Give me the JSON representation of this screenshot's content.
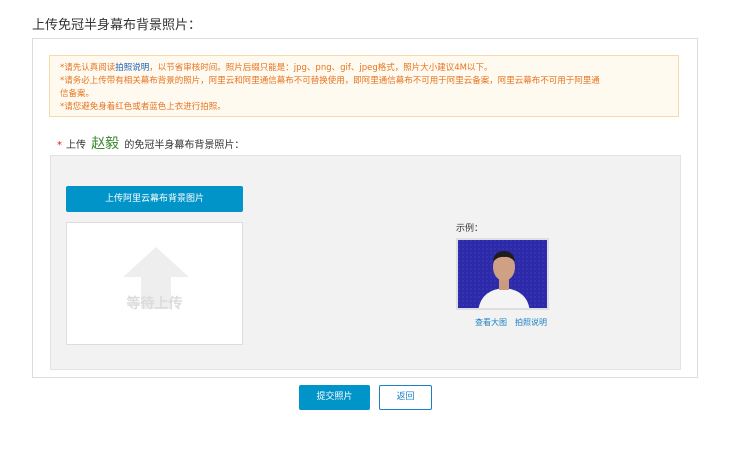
{
  "page": {
    "title": "上传免冠半身幕布背景照片："
  },
  "notice": {
    "line1_prefix": "*请先认真阅读",
    "line1_link": "拍照说明",
    "line1_suffix": "，以节省审核时间。照片后缀只能是：jpg、png、gif、jpeg格式，照片大小建议4M以下。",
    "line2": "*请务必上传带有相关幕布背景的照片，阿里云和阿里通信幕布不可替换使用，即阿里通信幕布不可用于阿里云备案，阿里云幕布不可用于阿里通",
    "line3": "信备案。",
    "line4": "*请您避免身着红色或者蓝色上衣进行拍照。"
  },
  "upload": {
    "required_mark": "*",
    "label_prefix": "上传",
    "person_name": "赵毅",
    "label_suffix": "的免冠半身幕布背景照片：",
    "button_label": "上传阿里云幕布背景图片",
    "placeholder_text": "等待上传"
  },
  "example": {
    "label": "示例：",
    "view_large": "查看大图",
    "photo_guide": "拍照说明"
  },
  "actions": {
    "submit": "提交照片",
    "back": "返回"
  },
  "colors": {
    "accent": "#0094c8",
    "warning_text": "#e67320",
    "name_green": "#3a8a2e",
    "backdrop_blue": "#2c2aa8"
  }
}
